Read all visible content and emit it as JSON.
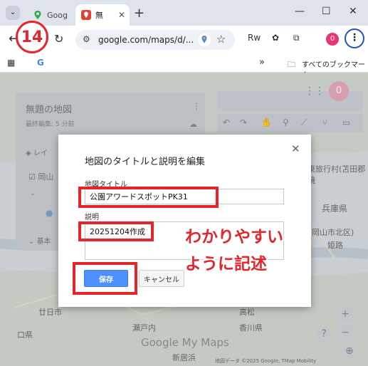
{
  "browser": {
    "tabs": [
      {
        "label": "Goog"
      },
      {
        "label": "無"
      }
    ],
    "url": "google.com/maps/d/...",
    "profile_initial": "0",
    "bookmarks_folder": "すべてのブックマーク",
    "bookmarks_more": "»"
  },
  "annotation": {
    "step_number": "14",
    "callout_line1": "わかりやすい",
    "callout_line2": "ように記述",
    "color": "#e6242b"
  },
  "mymaps": {
    "map_title": "無題の地図",
    "last_edit": "最終編集: 5 分前",
    "layer_label": "レイ",
    "layer_item": "岡山",
    "base_map": "基本",
    "account_initial": "0"
  },
  "map_labels": {
    "l1": "東旅行村(苫田郡鏡",
    "l2": "兵庫県",
    "l3": "岡山市北区)",
    "l4": "姫路",
    "l5": "高松",
    "l6": "香川県",
    "l7": "瀬戸内",
    "l8": "新居浜",
    "l9": "廿日市",
    "l10": "口県",
    "watermark": "Google My Maps",
    "attribution": "地図データ ©2025 Google, TMap Mobility"
  },
  "dialog": {
    "title": "地図のタイトルと説明を編集",
    "title_label": "地図タイトル",
    "title_value": "公園アワードスポットPK31",
    "desc_label": "説明",
    "desc_value": "20251204作成",
    "save_label": "保存",
    "cancel_label": "キャンセル"
  },
  "colors": {
    "primary_button": "#4d90fe",
    "highlight": "#e6242b"
  }
}
